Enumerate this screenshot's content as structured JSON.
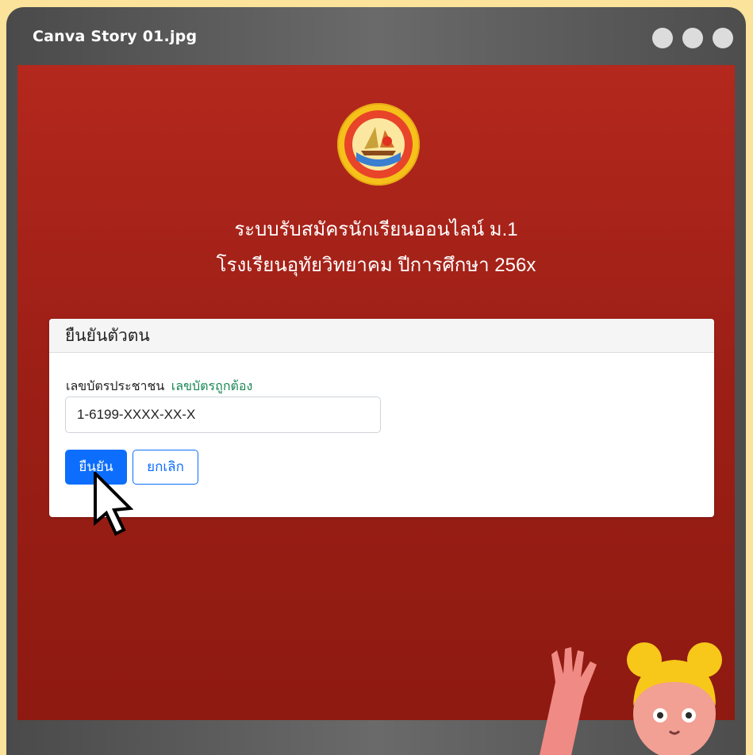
{
  "window": {
    "title": "Canva Story 01.jpg",
    "controls": [
      "dot-1",
      "dot-2",
      "dot-3"
    ]
  },
  "page": {
    "heading_line1": "ระบบรับสมัครนักเรียนออนไลน์ ม.1",
    "heading_line2": "โรงเรียนอุทัยวิทยาคม ปีการศึกษา 256x"
  },
  "card": {
    "header": "ยืนยันตัวตน",
    "field_label": "เลขบัตรประชาชน",
    "validation_text": "เลขบัตรถูกต้อง",
    "id_value": "1-6199-XXXX-XX-X",
    "confirm_label": "ยืนยัน",
    "cancel_label": "ยกเลิก"
  },
  "colors": {
    "background": "#fbe39b",
    "screen": "#9d1f16",
    "primary": "#0d6efd",
    "success": "#198754"
  },
  "icons": {
    "logo": "school-emblem-icon",
    "cursor": "mouse-pointer-icon"
  }
}
